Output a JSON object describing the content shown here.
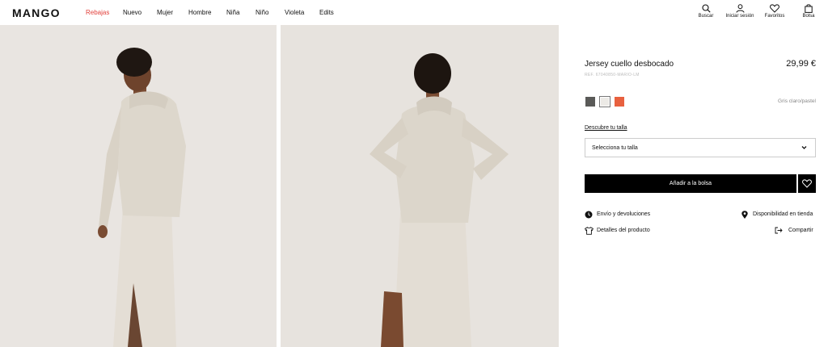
{
  "brand": {
    "logo": "MANGO"
  },
  "nav": {
    "items": [
      {
        "label": "Rebajas",
        "highlight": true
      },
      {
        "label": "Nuevo"
      },
      {
        "label": "Mujer"
      },
      {
        "label": "Hombre"
      },
      {
        "label": "Niña"
      },
      {
        "label": "Niño"
      },
      {
        "label": "Violeta"
      },
      {
        "label": "Edits"
      }
    ],
    "highlight_color": "#e2403b"
  },
  "tools": {
    "search": {
      "label": "Buscar",
      "icon": "search-icon"
    },
    "login": {
      "label": "Iniciar sesión",
      "icon": "user-icon"
    },
    "favorites": {
      "label": "Favoritos",
      "icon": "heart-icon"
    },
    "bag": {
      "label": "Bolsa",
      "icon": "bag-icon"
    }
  },
  "product": {
    "title": "Jersey cuello desbocado",
    "price": "29,99 €",
    "reference": "REF. 67040850-MARIO-LM",
    "colors": [
      {
        "hex": "#5a5a58"
      },
      {
        "hex": "#eceae6",
        "selected": true
      },
      {
        "hex": "#e8613f"
      }
    ],
    "color_name": "Gris claro/pastel",
    "size_link": "Descubre tu talla",
    "size_select": "Selecciona tu talla",
    "add_to_bag": "Añadir a la bolsa",
    "links": {
      "shipping": "Envío y devoluciones",
      "store_availability": "Disponibilidad en tienda",
      "details": "Detalles del producto",
      "share": "Compartir"
    }
  }
}
